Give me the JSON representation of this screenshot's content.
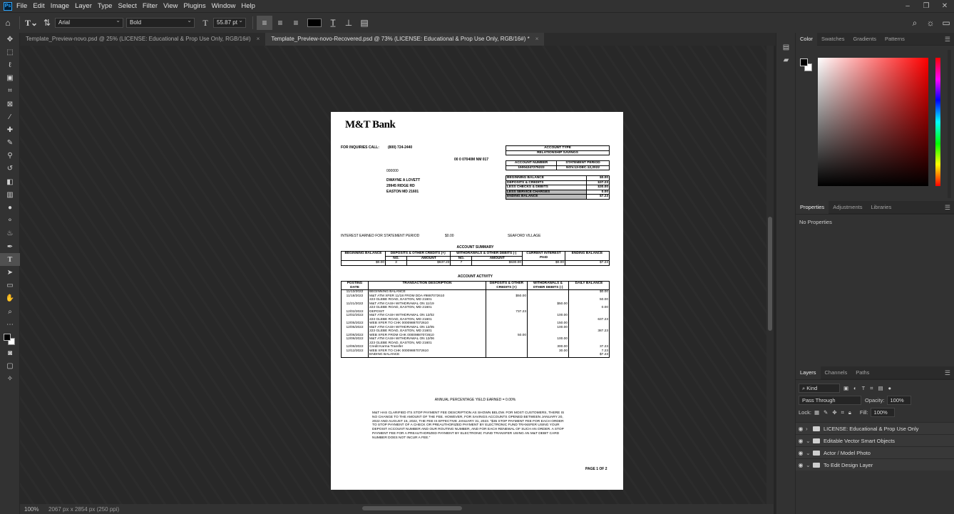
{
  "menubar": {
    "items": [
      "File",
      "Edit",
      "Image",
      "Layer",
      "Type",
      "Select",
      "Filter",
      "View",
      "Plugins",
      "Window",
      "Help"
    ]
  },
  "options": {
    "font_family": "Arial",
    "font_style": "Bold",
    "font_size": "55.87 pt"
  },
  "tabs": [
    {
      "label": "Template_Preview-novo.psd @ 25% (LICENSE: Educational & Prop Use Only, RGB/16#)",
      "active": false
    },
    {
      "label": "Template_Preview-novo-Recovered.psd @ 73% (LICENSE: Educational & Prop Use Only, RGB/16#) *",
      "active": true
    }
  ],
  "status": {
    "zoom": "100%",
    "dims": "2067 px x 2854 px (250 ppi)"
  },
  "panels": {
    "color_tabs": [
      "Color",
      "Swatches",
      "Gradients",
      "Patterns"
    ],
    "props_tabs": [
      "Properties",
      "Adjustments",
      "Libraries"
    ],
    "props_text": "No Properties",
    "layers_tabs": [
      "Layers",
      "Channels",
      "Paths"
    ],
    "kind": "Kind",
    "blend": "Pass Through",
    "opacity_label": "Opacity:",
    "opacity": "100%",
    "lock_label": "Lock:",
    "fill_label": "Fill:",
    "fill": "100%",
    "layers": [
      "LICENSE: Educational & Prop Use Only",
      "Editable Vector Smart Objects",
      "Actor / Model Photo",
      "To Edit Design Layer"
    ]
  },
  "statement": {
    "bank": "M&T Bank",
    "inquiries_label": "FOR INQUIRIES CALL:",
    "phone": "(800) 724-2440",
    "code": "00   0 07040M NM  017",
    "zeros": "000000",
    "name": "DWAYNE A LOVETT",
    "addr1": "29945 RIDGE RD",
    "addr2": "EASTON MD 21601",
    "account_type_label": "ACCOUNT TYPE",
    "account_type": "RELATIONSHIP SAVINGS",
    "acct_num_label": "ACCOUNT NUMBER",
    "period_label": "STATEMENT PERIOD",
    "acct_num": "15004247275222",
    "period": "NOV.13-DEC.12,2022",
    "balances": [
      {
        "label": "BEGINNING BALANCE",
        "value": "$0.00"
      },
      {
        "label": "DEPOSITS & CREDITS",
        "value": "$37.23"
      },
      {
        "label": "LESS CHECKS & DEBITS",
        "value": "$30.00"
      },
      {
        "label": "LESS SERVICE CHARGES",
        "value": "0.00"
      },
      {
        "label": "ENDING BALANCE",
        "value": "$7.23"
      }
    ],
    "interest_label": "INTEREST EARNED FOR STATEMENT PERIOD",
    "interest": "$0.00",
    "branch": "SEAFORD VILLAGE",
    "summary_title": "ACCOUNT SUMMARY",
    "summary_headers": [
      "BEGINNING BALANCE",
      "DEPOSITS & OTHER CREDITS (+)",
      "WITHDRAWALS & OTHER DEBITS (-)",
      "CURRENT INTEREST PAID",
      "ENDING BALANCE"
    ],
    "summary_sub": [
      "NO.",
      "AMOUNT",
      "NO.",
      "AMOUNT"
    ],
    "summary_values": [
      "$0.00",
      "3",
      "$637.23",
      "7",
      "$630.00",
      "$0.00",
      "$7.23"
    ],
    "activity_title": "ACCOUNT ACTIVITY",
    "activity_headers": [
      "POSTING DATE",
      "TRANSACTION DESCRIPTION",
      "DEPOSITS & OTHER CREDITS (+)",
      "WITHDRAWALS & OTHER DEBITS (-)",
      "DAILY BALANCE"
    ],
    "activity": [
      {
        "date": "11/13/2022",
        "desc": "BEGINNING BALANCE",
        "dep": "",
        "wd": "",
        "bal": "$0.00"
      },
      {
        "date": "11/18/2022",
        "desc": "M&T ATM XFER 11/18 FROM DDA #9887072610\n223 GLEBE ROAD, EASTON, MD 21601",
        "dep": "$50.00",
        "wd": "",
        "bal": "50.00"
      },
      {
        "date": "11/21/2022",
        "desc": "M&T ATM CASH WITHDRAWAL ON 11/19\n223 GLEBE ROAD, EASTON, MD 21601",
        "dep": "",
        "wd": "$50.00",
        "bal": "0.00"
      },
      {
        "date": "12/02/2022",
        "desc": "DEPOSIT",
        "dep": "737.23",
        "wd": "",
        "bal": ""
      },
      {
        "date": "12/02/2022",
        "desc": "M&T ATM CASH WITHDRAWAL ON 12/02\n223 GLEBE ROAD, EASTON, MD 21601",
        "dep": "",
        "wd": "100.00",
        "bal": "637.23"
      },
      {
        "date": "12/05/2022",
        "desc": "WEB XFER TO CHK  00009887072610",
        "dep": "",
        "wd": "150.00",
        "bal": ""
      },
      {
        "date": "12/05/2022",
        "desc": "M&T ATM CASH WITHDRAWAL ON 12/05\n223 GLEBE ROAD, EASTON, MD 21601",
        "dep": "",
        "wd": "100.00",
        "bal": "387.23"
      },
      {
        "date": "12/06/2022",
        "desc": "WEB XFER FROM CHK 00009887072610",
        "dep": "50.00",
        "wd": "",
        "bal": ""
      },
      {
        "date": "12/06/2022",
        "desc": "M&T ATM CASH WITHDRAWAL ON 12/06\n223 GLEBE ROAD, EASTON, MD 21601",
        "dep": "",
        "wd": "100.00",
        "bal": ""
      },
      {
        "date": "12/06/2022",
        "desc": "Credit Karma Transfer",
        "dep": "",
        "wd": "300.00",
        "bal": "37.23"
      },
      {
        "date": "12/12/2022",
        "desc": "WEB XFER TO CHK  00009887072610",
        "dep": "",
        "wd": "30.00",
        "bal": "7.23"
      },
      {
        "date": "",
        "desc": "ENDING BALANCE",
        "dep": "",
        "wd": "",
        "bal": "$7.23"
      }
    ],
    "apy": "ANNUAL PERCENTAGE YIELD EARNED = 0.00%",
    "notice": "M&T HAS CLARIFIED ITS STOP PAYMENT FEE DESCRIPTION AS SHOWN BELOW. FOR MOST CUSTOMERS, THERE IS NO CHANGE TO THE AMOUNT OF THE FEE. HOWEVER, FOR SAVINGS ACCOUNTS OPENED BETWEEN JANUARY 20, 2022 AND AUGUST 15, 2022, THE FEE IS EFFECTIVE JANUARY 31, 2023. \"$35 STOP PAYMENT FEE FOR EACH ORDER TO STOP PAYMENT OF A CHECK OR PREAUTHORIZED PAYMENT BY ELECTRONIC FUND TRANSFER USING YOUR DEPOSIT ACCOUNT NUMBER AND OUR ROUTING NUMBER, AND FOR EACH RENEWAL OF SUCH AN ORDER. A STOP PAYMENT FEE FOR A PREAUTHORIZED PAYMENT BY ELECTRONIC FUND TRANSFER USING AN M&T DEBIT CARD NUMBER DOES NOT INCUR A FEE.\"",
    "page": "PAGE 1 OF 2"
  }
}
